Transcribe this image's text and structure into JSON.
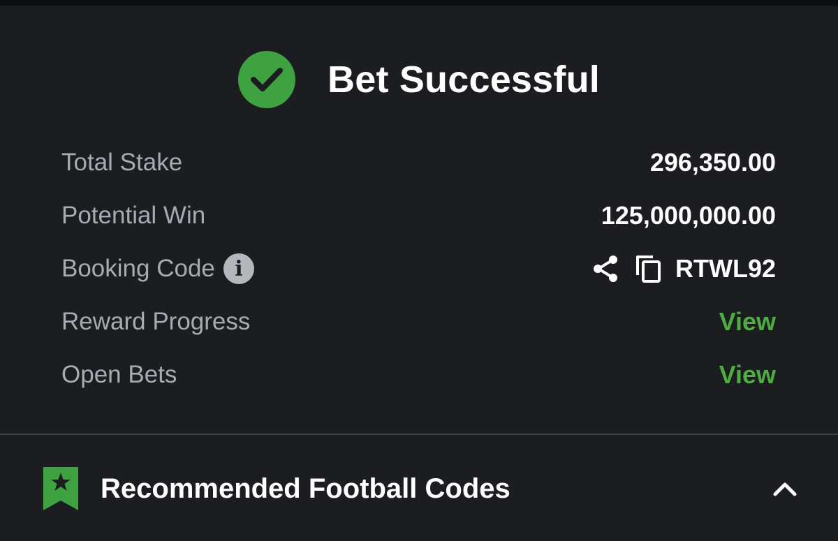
{
  "header": {
    "title": "Bet Successful",
    "icon": "check-circle-icon",
    "icon_color": "#3da23f"
  },
  "summary": {
    "total_stake": {
      "label": "Total Stake",
      "value": "296,350.00"
    },
    "potential_win": {
      "label": "Potential Win",
      "value": "125,000,000.00"
    },
    "booking_code": {
      "label": "Booking Code",
      "info_glyph": "i",
      "value": "RTWL92"
    },
    "reward_progress": {
      "label": "Reward Progress",
      "action": "View"
    },
    "open_bets": {
      "label": "Open Bets",
      "action": "View"
    }
  },
  "recommended": {
    "title": "Recommended Football Codes",
    "icon": "bookmark-star-icon",
    "toggle_icon": "chevron-up-icon"
  },
  "colors": {
    "background": "#1b1d21",
    "accent_green": "#4eac43",
    "label_gray": "#a9abb3"
  }
}
